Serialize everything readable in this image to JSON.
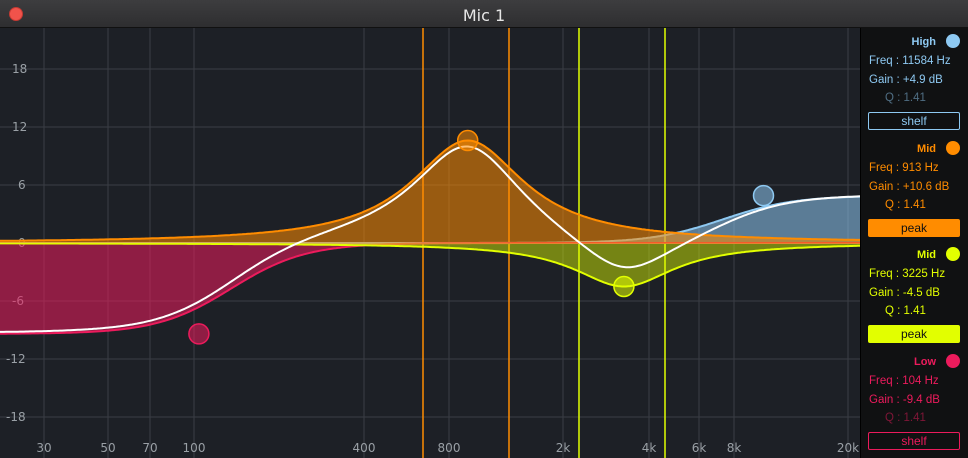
{
  "window": {
    "title": "Mic 1"
  },
  "colors": {
    "high": "#8ec9f2",
    "mid_orange": "#ff8c00",
    "mid_yellow": "#e2ff00",
    "low": "#ec1b5c",
    "grid": "#3a3e45",
    "curve": "#ffffff"
  },
  "graph": {
    "y_ticks": [
      "18",
      "12",
      "6",
      "0",
      "-6",
      "-12",
      "-18"
    ],
    "x_ticks": [
      "30",
      "50",
      "70",
      "100",
      "400",
      "800",
      "2k",
      "4k",
      "6k",
      "8k",
      "20k"
    ]
  },
  "bands": [
    {
      "name": "High",
      "color": "#8ec9f2",
      "freq": "Freq : 11584 Hz",
      "gain": "Gain : +4.9 dB",
      "q": "Q : 1.41",
      "type": "shelf",
      "q_dim": true,
      "active": false
    },
    {
      "name": "Mid",
      "color": "#ff8c00",
      "freq": "Freq : 913 Hz",
      "gain": "Gain : +10.6 dB",
      "q": "Q : 1.41",
      "type": "peak",
      "q_dim": false,
      "active": true
    },
    {
      "name": "Mid",
      "color": "#e2ff00",
      "freq": "Freq : 3225 Hz",
      "gain": "Gain : -4.5 dB",
      "q": "Q : 1.41",
      "type": "peak",
      "q_dim": false,
      "active": true
    },
    {
      "name": "Low",
      "color": "#ec1b5c",
      "freq": "Freq : 104 Hz",
      "gain": "Gain : -9.4 dB",
      "q": "Q : 1.41",
      "type": "shelf",
      "q_dim": true,
      "active": false
    }
  ]
}
